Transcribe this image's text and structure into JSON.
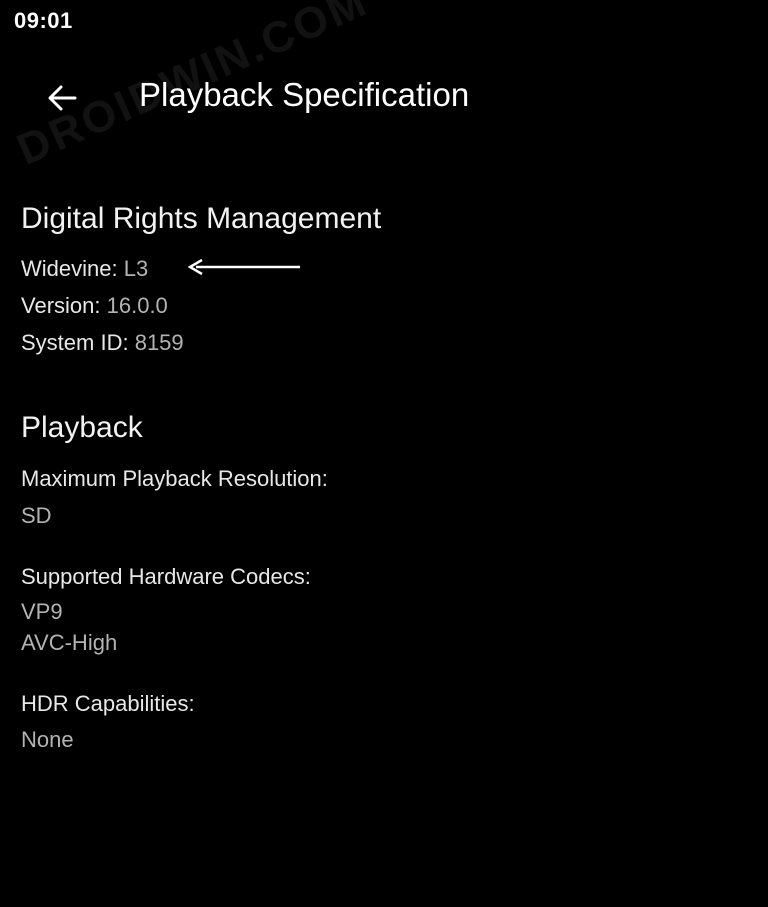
{
  "status_bar": {
    "time": "09:01"
  },
  "header": {
    "back_icon": "arrow-left-icon",
    "title": "Playback Specification"
  },
  "watermark": "DROIDWIN.COM",
  "drm": {
    "title": "Digital Rights Management",
    "widevine_label": "Widevine:",
    "widevine_value": "L3",
    "version_label": "Version:",
    "version_value": "16.0.0",
    "system_id_label": "System ID:",
    "system_id_value": "8159"
  },
  "playback": {
    "title": "Playback",
    "max_resolution_label": "Maximum Playback Resolution:",
    "max_resolution_value": "SD",
    "codecs_label": "Supported Hardware Codecs:",
    "codecs": [
      "VP9",
      "AVC-High"
    ],
    "hdr_label": "HDR Capabilities:",
    "hdr_value": "None"
  },
  "colors": {
    "background": "#000000",
    "text": "#e8e8e8",
    "muted": "#b3b3b3"
  }
}
